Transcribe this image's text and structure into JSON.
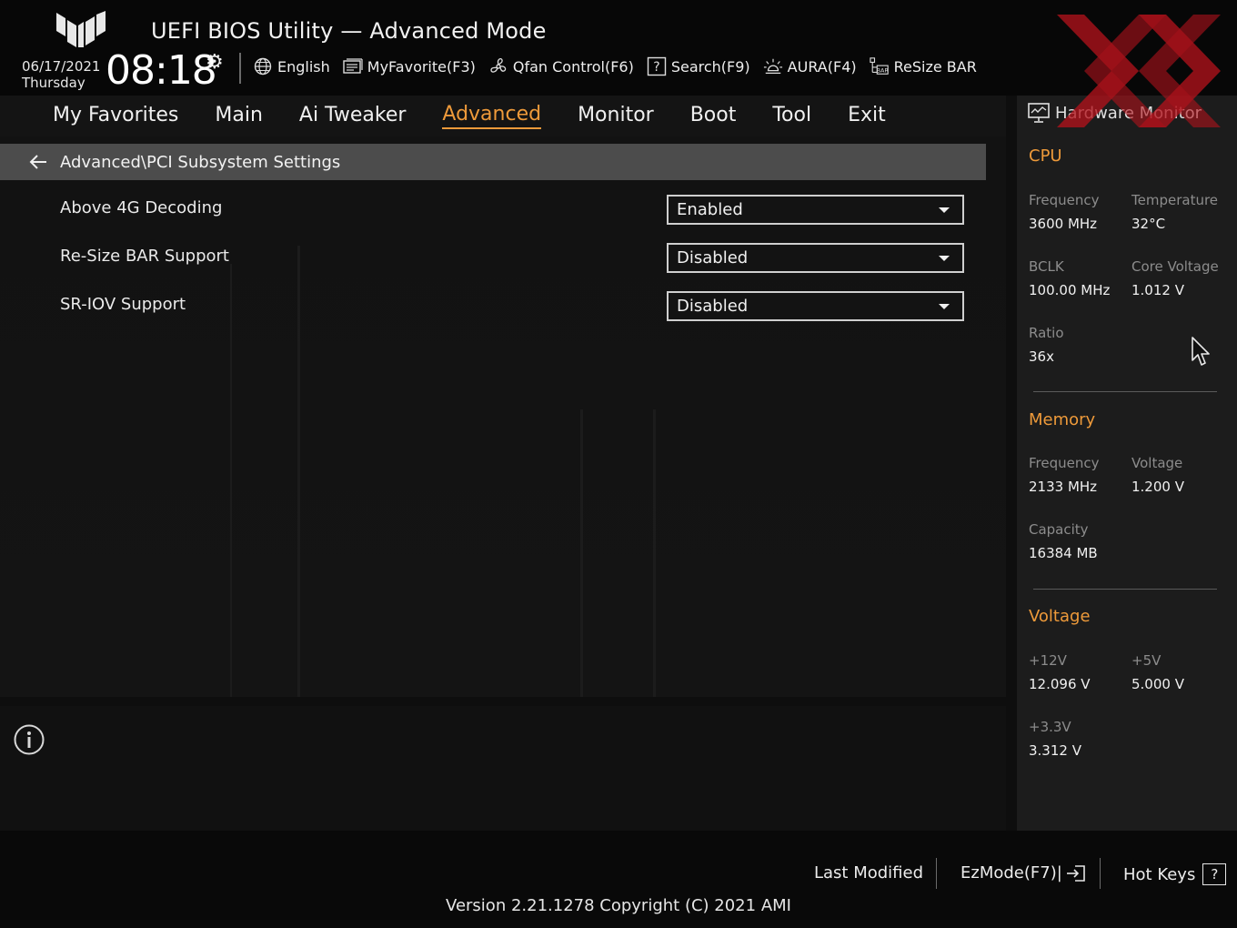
{
  "header": {
    "title": "UEFI BIOS Utility — Advanced Mode",
    "date": "06/17/2021",
    "day": "Thursday",
    "time": "08:18",
    "tools": [
      {
        "label": "English",
        "icon": "globe-icon"
      },
      {
        "label": "MyFavorite(F3)",
        "icon": "favorite-list-icon"
      },
      {
        "label": "Qfan Control(F6)",
        "icon": "fan-icon"
      },
      {
        "label": "Search(F9)",
        "icon": "search-help-icon"
      },
      {
        "label": "AURA(F4)",
        "icon": "aura-light-icon"
      },
      {
        "label": "ReSize BAR",
        "icon": "resize-bar-icon"
      }
    ]
  },
  "nav": {
    "tabs": [
      {
        "label": "My Favorites"
      },
      {
        "label": "Main"
      },
      {
        "label": "Ai Tweaker"
      },
      {
        "label": "Advanced",
        "active": true
      },
      {
        "label": "Monitor"
      },
      {
        "label": "Boot"
      },
      {
        "label": "Tool"
      },
      {
        "label": "Exit"
      }
    ]
  },
  "breadcrumb": "Advanced\\PCI Subsystem Settings",
  "settings": [
    {
      "label": "Above 4G Decoding",
      "value": "Enabled"
    },
    {
      "label": "Re-Size BAR Support",
      "value": "Disabled"
    },
    {
      "label": "SR-IOV Support",
      "value": "Disabled"
    }
  ],
  "hardware_monitor": {
    "title": "Hardware Monitor",
    "cpu": {
      "title": "CPU",
      "frequency_label": "Frequency",
      "frequency": "3600 MHz",
      "temperature_label": "Temperature",
      "temperature": "32°C",
      "bclk_label": "BCLK",
      "bclk": "100.00 MHz",
      "core_voltage_label": "Core Voltage",
      "core_voltage": "1.012 V",
      "ratio_label": "Ratio",
      "ratio": "36x"
    },
    "memory": {
      "title": "Memory",
      "frequency_label": "Frequency",
      "frequency": "2133 MHz",
      "voltage_label": "Voltage",
      "voltage": "1.200 V",
      "capacity_label": "Capacity",
      "capacity": "16384 MB"
    },
    "voltage": {
      "title": "Voltage",
      "v12_label": "+12V",
      "v12": "12.096 V",
      "v5_label": "+5V",
      "v5": "5.000 V",
      "v33_label": "+3.3V",
      "v33": "3.312 V"
    }
  },
  "footer": {
    "last_modified": "Last Modified",
    "ez_mode": "EzMode(F7)|",
    "hot_keys": "Hot Keys",
    "hot_keys_glyph": "?",
    "version": "Version 2.21.1278 Copyright (C) 2021 AMI"
  },
  "colors": {
    "accent": "#ee9a3a",
    "brand_red": "#b3121b"
  }
}
